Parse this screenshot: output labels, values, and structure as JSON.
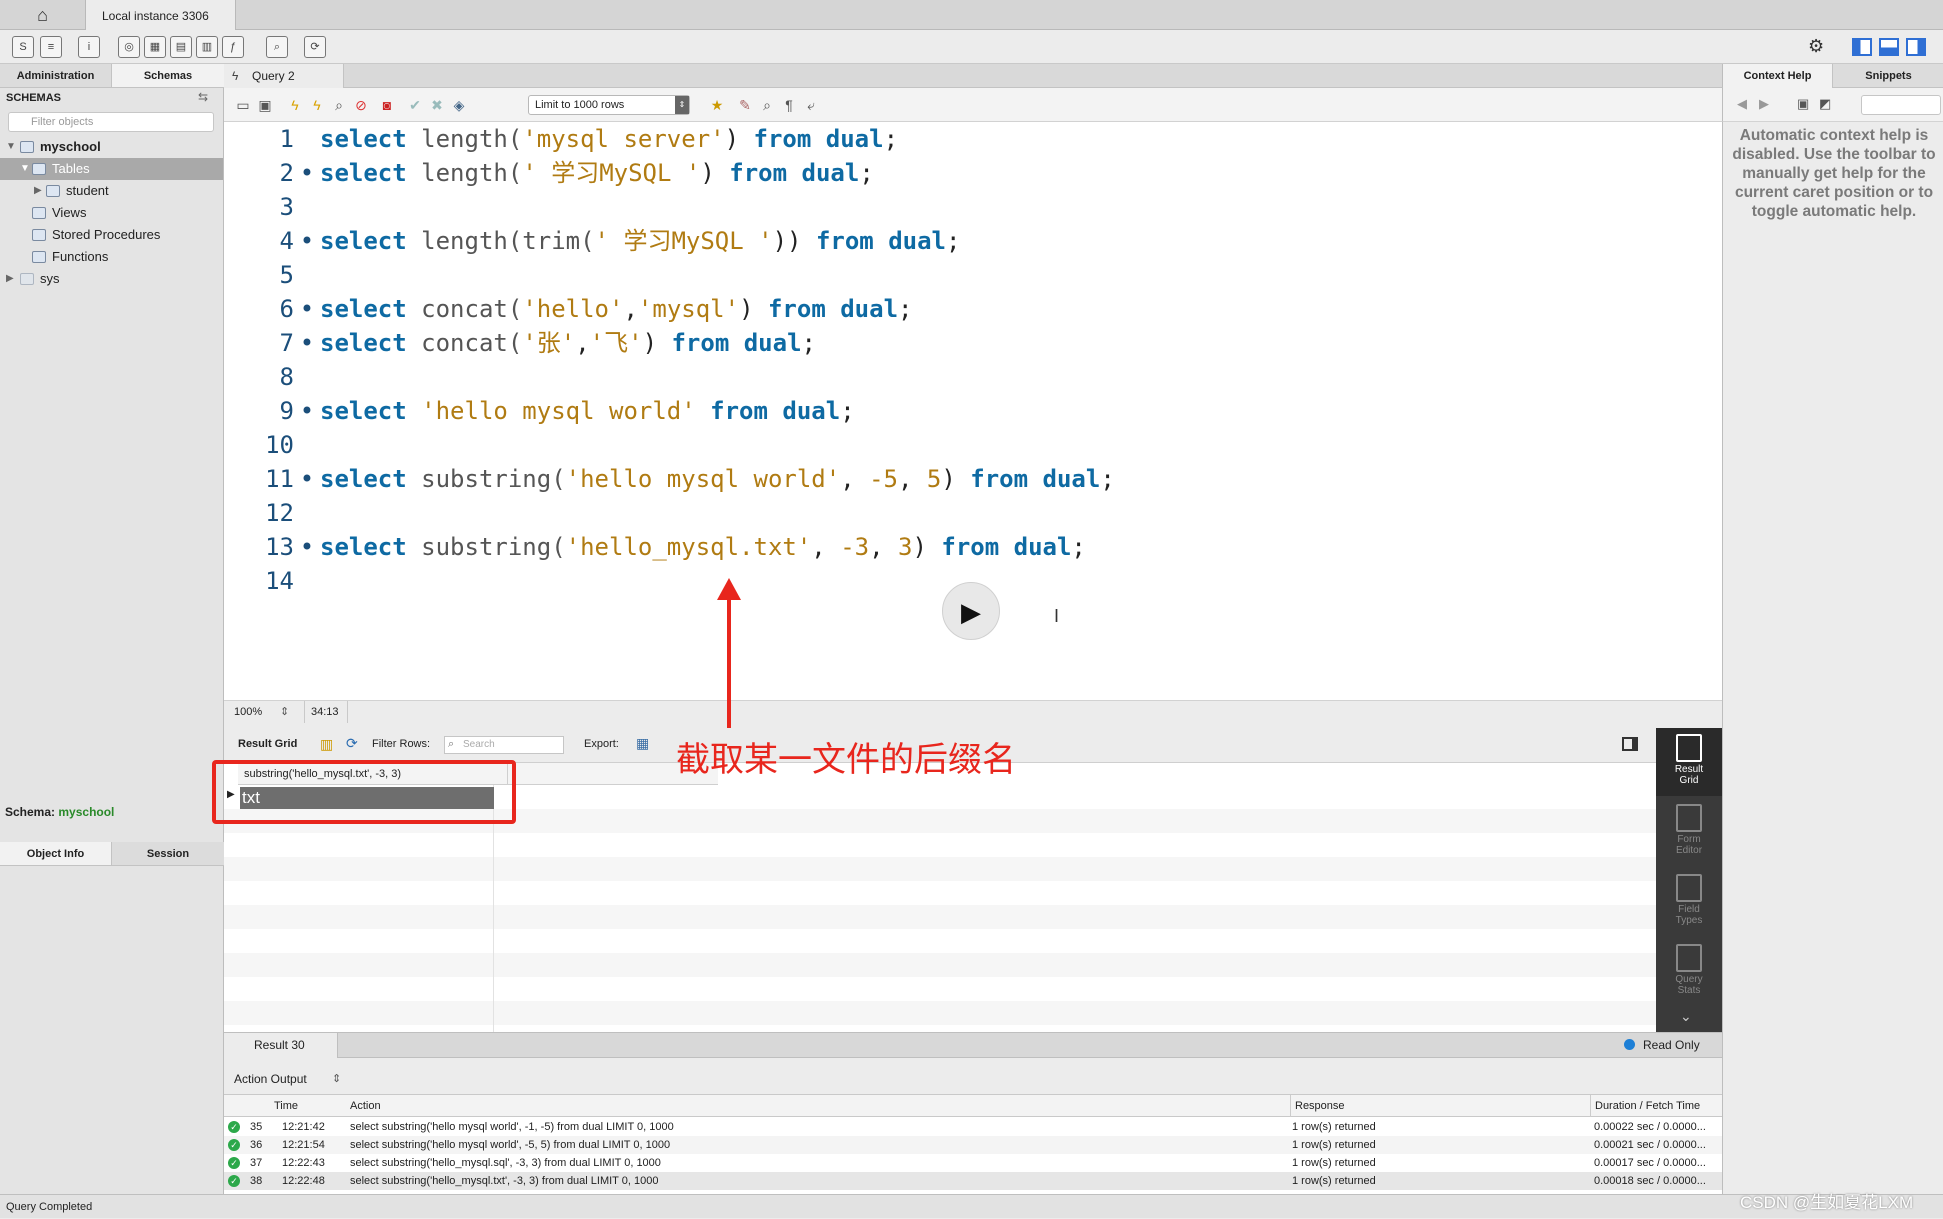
{
  "tabs": {
    "home_icon": "home-icon",
    "instance": "Local instance 3306"
  },
  "sidebar": {
    "seg_admin": "Administration",
    "seg_schemas": "Schemas",
    "title": "SCHEMAS",
    "filter_placeholder": "Filter objects",
    "tree": {
      "db1": "myschool",
      "tables": "Tables",
      "table1": "student",
      "views": "Views",
      "procs": "Stored Procedures",
      "funcs": "Functions",
      "db2": "sys"
    },
    "seg_objinfo": "Object Info",
    "seg_session": "Session",
    "schema_label": "Schema:",
    "schema_value": "myschool"
  },
  "query_tab": {
    "label": "Query 2"
  },
  "editor_toolbar": {
    "limit": "Limit to 1000 rows"
  },
  "editor": {
    "lines": [
      {
        "n": "1"
      },
      {
        "n": "2"
      },
      {
        "n": "3"
      },
      {
        "n": "4"
      },
      {
        "n": "5"
      },
      {
        "n": "6"
      },
      {
        "n": "7"
      },
      {
        "n": "8"
      },
      {
        "n": "9"
      },
      {
        "n": "10"
      },
      {
        "n": "11"
      },
      {
        "n": "12"
      },
      {
        "n": "13"
      },
      {
        "n": "14"
      }
    ],
    "kw_select": "select",
    "kw_from": "from",
    "kw_dual": "dual",
    "l1_fn": "length(",
    "l1_str": "'mysql server'",
    "l2_fn": "length(",
    "l2_str": "' 学习MySQL '",
    "l4_fn": "length(trim(",
    "l4_str": "' 学习MySQL '",
    "l4_close": "))",
    "l6_fn": "concat(",
    "l6_s1": "'hello'",
    "l6_s2": "'mysql'",
    "l7_fn": "concat(",
    "l7_s1": "'张'",
    "l7_s2": "'飞'",
    "l9_str": "'hello mysql world'",
    "l11_fn": "substring(",
    "l11_str": "'hello mysql world'",
    "l11_n1": "-5",
    "l11_n2": "5",
    "l13_fn": "substring(",
    "l13_str": "'hello_mysql.txt'",
    "l13_n1": "-3",
    "l13_n2": "3"
  },
  "editor_status": {
    "zoom": "100%",
    "position": "34:13"
  },
  "result_toolbar": {
    "grid_label": "Result Grid",
    "filter_label": "Filter Rows:",
    "search_placeholder": "Search",
    "export_label": "Export:"
  },
  "grid": {
    "column": "substring('hello_mysql.txt', -3, 3)",
    "value": "txt"
  },
  "annotation": {
    "text": "截取某一文件的后缀名"
  },
  "result_side": [
    {
      "label": "Result\nGrid"
    },
    {
      "label": "Form\nEditor"
    },
    {
      "label": "Field\nTypes"
    },
    {
      "label": "Query\nStats"
    }
  ],
  "result_tab": {
    "label": "Result 30",
    "readonly": "Read Only"
  },
  "action_output": {
    "label": "Action Output",
    "headers": [
      "Time",
      "Action",
      "Response",
      "Duration / Fetch Time"
    ],
    "rows": [
      {
        "num": "35",
        "time": "12:21:42",
        "action": "select substring('hello mysql world', -1, -5) from dual LIMIT 0, 1000",
        "response": "1 row(s) returned",
        "duration": "0.00022 sec / 0.0000..."
      },
      {
        "num": "36",
        "time": "12:21:54",
        "action": "select substring('hello mysql world', -5, 5) from dual LIMIT 0, 1000",
        "response": "1 row(s) returned",
        "duration": "0.00021 sec / 0.0000..."
      },
      {
        "num": "37",
        "time": "12:22:43",
        "action": "select substring('hello_mysql.sql', -3, 3) from dual LIMIT 0, 1000",
        "response": "1 row(s) returned",
        "duration": "0.00017 sec / 0.0000..."
      },
      {
        "num": "38",
        "time": "12:22:48",
        "action": "select substring('hello_mysql.txt', -3, 3) from dual LIMIT 0, 1000",
        "response": "1 row(s) returned",
        "duration": "0.00018 sec / 0.0000..."
      }
    ]
  },
  "context": {
    "tab_help": "Context Help",
    "tab_snippets": "Snippets",
    "message": "Automatic context help is disabled. Use the toolbar to manually get help for the current caret position or to toggle automatic help."
  },
  "status": {
    "text": "Query Completed"
  },
  "watermark": "CSDN @生如夏花LXM"
}
